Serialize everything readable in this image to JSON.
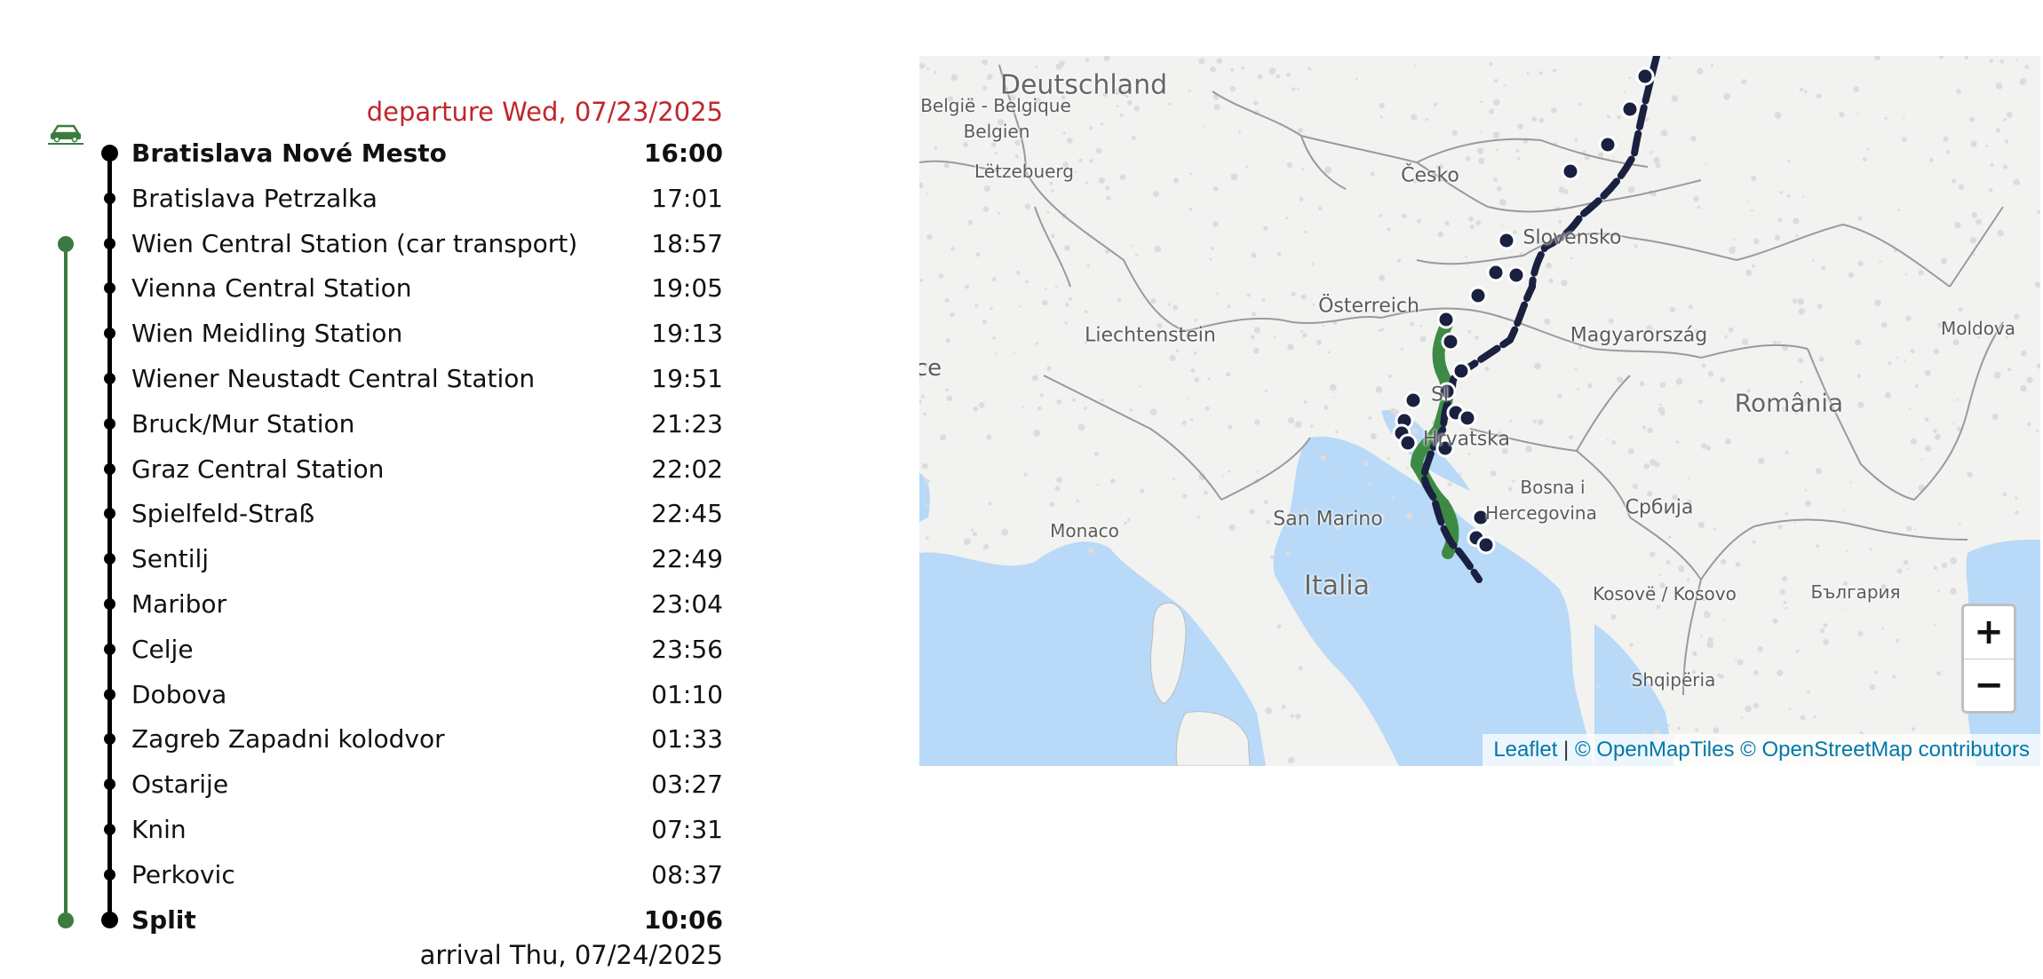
{
  "timetable": {
    "departure": "departure Wed, 07/23/2025",
    "arrival": "arrival Thu, 07/24/2025",
    "car_icon": "car-train-icon",
    "stops": [
      {
        "name": "Bratislava Nové Mesto",
        "time": "16:00",
        "terminal": true
      },
      {
        "name": "Bratislava Petrzalka",
        "time": "17:01"
      },
      {
        "name": "Wien Central Station (car transport)",
        "time": "18:57",
        "car_start": true
      },
      {
        "name": "Vienna Central Station",
        "time": "19:05"
      },
      {
        "name": "Wien Meidling Station",
        "time": "19:13"
      },
      {
        "name": "Wiener Neustadt Central Station",
        "time": "19:51"
      },
      {
        "name": "Bruck/Mur Station",
        "time": "21:23"
      },
      {
        "name": "Graz Central Station",
        "time": "22:02"
      },
      {
        "name": "Spielfeld-Straß",
        "time": "22:45"
      },
      {
        "name": "Sentilj",
        "time": "22:49"
      },
      {
        "name": "Maribor",
        "time": "23:04"
      },
      {
        "name": "Celje",
        "time": "23:56"
      },
      {
        "name": "Dobova",
        "time": "01:10"
      },
      {
        "name": "Zagreb Zapadni kolodvor",
        "time": "01:33"
      },
      {
        "name": "Ostarije",
        "time": "03:27"
      },
      {
        "name": "Knin",
        "time": "07:31"
      },
      {
        "name": "Perkovic",
        "time": "08:37"
      },
      {
        "name": "Split",
        "time": "10:06",
        "terminal": true,
        "car_end": true
      }
    ]
  },
  "map": {
    "labels": [
      {
        "text": "Deutschland",
        "size": 30
      },
      {
        "text": "België - Belgique",
        "size": 20
      },
      {
        "text": "Belgien",
        "size": 20
      },
      {
        "text": "Lëtzebuerg",
        "size": 20
      },
      {
        "text": "Česko",
        "size": 22
      },
      {
        "text": "Slovensko",
        "size": 22
      },
      {
        "text": "Österreich",
        "size": 22
      },
      {
        "text": "Liechtenstein",
        "size": 22
      },
      {
        "text": "Magyarország",
        "size": 22
      },
      {
        "text": "Moldova",
        "size": 20
      },
      {
        "text": "România",
        "size": 28
      },
      {
        "text": "ce",
        "size": 26
      },
      {
        "text": "Sl",
        "size": 22
      },
      {
        "text": "Hrvatska",
        "size": 22
      },
      {
        "text": "Bosna i",
        "size": 20
      },
      {
        "text": "Hercegovina",
        "size": 20
      },
      {
        "text": "Србија",
        "size": 22
      },
      {
        "text": "Monaco",
        "size": 20
      },
      {
        "text": "San Marino",
        "size": 22
      },
      {
        "text": "Italia",
        "size": 30
      },
      {
        "text": "Kosovë / Kosovo",
        "size": 20
      },
      {
        "text": "България",
        "size": 20
      },
      {
        "text": "Shqipëria",
        "size": 20
      }
    ],
    "zoom_in": "+",
    "zoom_out": "−",
    "attribution": {
      "leaflet": "Leaflet",
      "separator": " | ",
      "tiles": "© OpenMapTiles © OpenStreetMap contributors"
    },
    "colors": {
      "route": "#1a2040",
      "car_route": "#3d8a44",
      "land": "#f2f2f0",
      "water": "#b8d9f7",
      "border": "#9a9a9a"
    }
  },
  "colors": {
    "departure": "#c0262c",
    "car_line": "#3d7a40",
    "route_line": "#000000"
  }
}
